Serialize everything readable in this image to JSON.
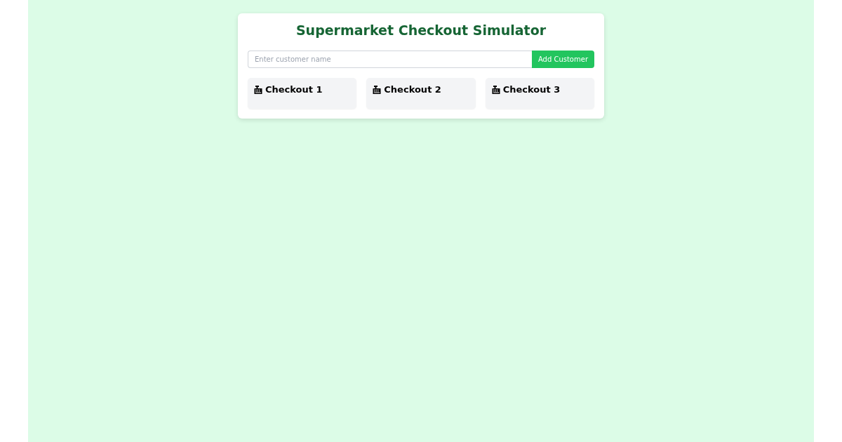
{
  "title": "Supermarket Checkout Simulator",
  "customer_input": {
    "placeholder": "Enter customer name"
  },
  "add_button": {
    "label": "Add Customer"
  },
  "checkouts": [
    {
      "name": "Checkout 1"
    },
    {
      "name": "Checkout 2"
    },
    {
      "name": "Checkout 3"
    }
  ]
}
